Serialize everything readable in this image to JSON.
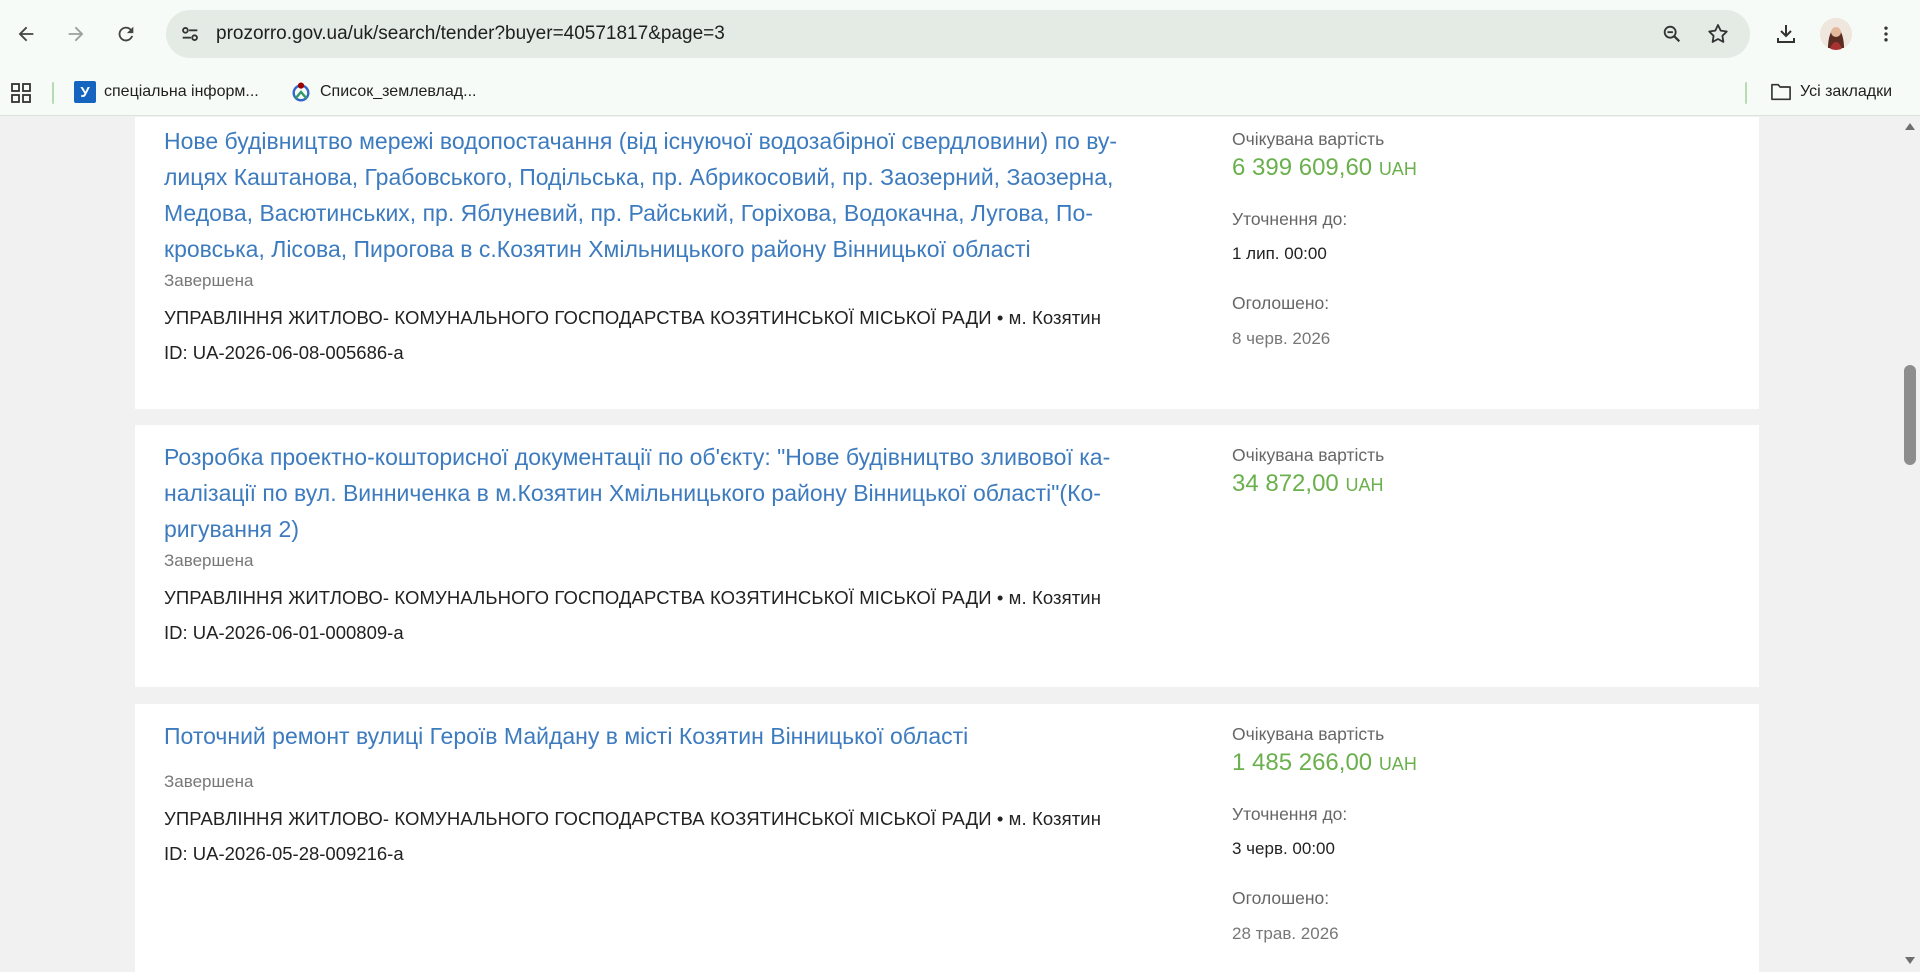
{
  "browser": {
    "url": "prozorro.gov.ua/uk/search/tender?buyer=40571817&page=3",
    "bookmarks": [
      {
        "label": "спеціальна інформ...",
        "favicon": "У"
      },
      {
        "label": "Список_землевлад..."
      }
    ],
    "all_bookmarks_label": "Усі закладки"
  },
  "tenders": [
    {
      "title": "Нове будівництво мережі водопостачання (від існуючої водозабірної свердловини) по ву-лицях Каштанова, Грабовського, Подільська, пр. Абрикосовий, пр. Заозерний, Заозерна, Медова, Васютинських, пр. Яблуневий, пр. Райський, Горіхова, Водокачна, Лугова, По-кровська, Лісова, Пирогова в с.Козятин Хмільницького району Вінницької області",
      "status": "Завершена",
      "buyer": "УПРАВЛІННЯ ЖИТЛОВО- КОМУНАЛЬНОГО ГОСПОДАРСТВА КОЗЯТИНСЬКОЇ МІСЬКОЇ РАДИ • м. Козятин",
      "id": "ID: UA-2026-06-08-005686-a",
      "expected_label": "Очікувана вартість",
      "amount": "6 399 609,60",
      "currency": "UAH",
      "clarification_label": "Уточнення до:",
      "clarification_value": "1 лип. 00:00",
      "announced_label": "Оголошено:",
      "announced_value": "8 черв. 2026"
    },
    {
      "title": "Розробка проектно-кошторисної документації по об'єкту: \"Нове будівництво зливової ка-налізації по вул. Винниченка в м.Козятин Хмільницького району Вінницької області\"(Ко-ригування 2)",
      "status": "Завершена",
      "buyer": "УПРАВЛІННЯ ЖИТЛОВО- КОМУНАЛЬНОГО ГОСПОДАРСТВА КОЗЯТИНСЬКОЇ МІСЬКОЇ РАДИ • м. Козятин",
      "id": "ID: UA-2026-06-01-000809-a",
      "expected_label": "Очікувана вартість",
      "amount": "34 872,00",
      "currency": "UAH"
    },
    {
      "title": "Поточний ремонт вулиці Героїв Майдану в місті Козятин Вінницької області",
      "status": "Завершена",
      "buyer": "УПРАВЛІННЯ ЖИТЛОВО- КОМУНАЛЬНОГО ГОСПОДАРСТВА КОЗЯТИНСЬКОЇ МІСЬКОЇ РАДИ • м. Козятин",
      "id": "ID: UA-2026-05-28-009216-a",
      "expected_label": "Очікувана вартість",
      "amount": "1 485 266,00",
      "currency": "UAH",
      "clarification_label": "Уточнення до:",
      "clarification_value": "3 черв. 00:00",
      "announced_label": "Оголошено:",
      "announced_value": "28 трав. 2026"
    }
  ]
}
